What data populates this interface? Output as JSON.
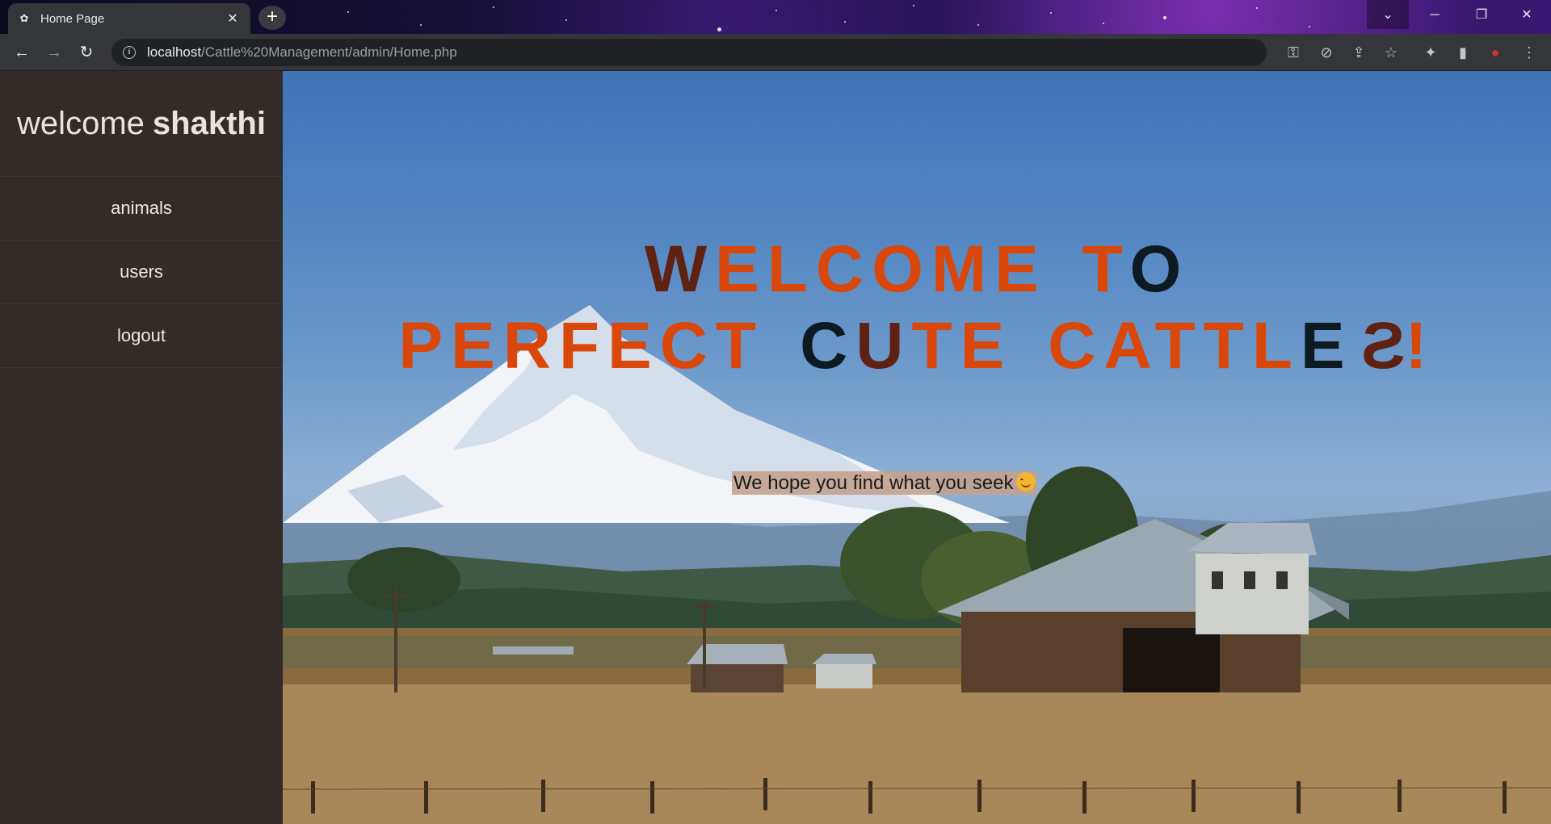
{
  "browser": {
    "tab_title": "Home Page",
    "url_host": "localhost",
    "url_path": "/Cattle%20Management/admin/Home.php"
  },
  "sidebar": {
    "welcome_prefix": "welcome",
    "username": "shakthi",
    "items": [
      {
        "label": "animals"
      },
      {
        "label": "users"
      },
      {
        "label": "logout"
      }
    ]
  },
  "hero": {
    "line1": [
      {
        "text": "W",
        "color": "#5e2112"
      },
      {
        "text": "ELCOME",
        "color": "#d9470a"
      },
      {
        "text": "T",
        "color": "#d9470a"
      },
      {
        "text": "O",
        "color": "#0d1a22"
      }
    ],
    "line2_words": [
      "PERFECT",
      "CUTE",
      "CATTLES!"
    ],
    "tagline": "We hope you find what you seek",
    "tagline_emoji": "smiling-face-icon"
  },
  "colors": {
    "orange": "#d9470a",
    "brown": "#5e2112",
    "black": "#0d1a22",
    "sidebar_bg": "#332b27"
  }
}
